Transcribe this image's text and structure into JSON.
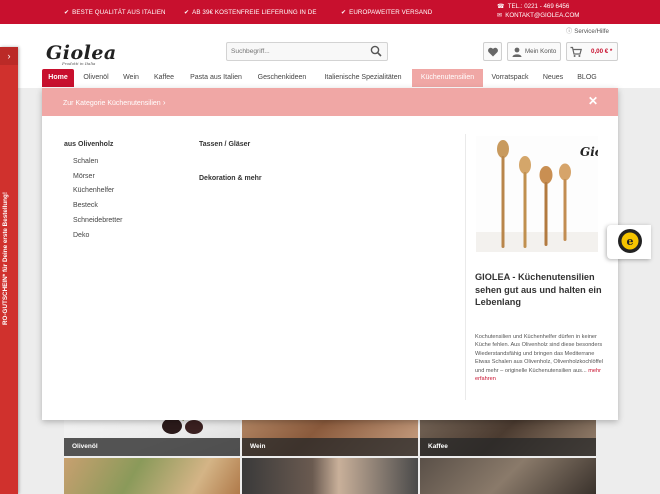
{
  "topbar": {
    "usps": [
      "BESTE QUALITÄT AUS ITALIEN",
      "AB 39€ KOSTENFREIE LIEFERUNG IN DE",
      "EUROPAWEITER VERSAND"
    ],
    "phone": "TEL.: 0221 - 469 6456",
    "email": "KONTAKT@GIOLEA.COM"
  },
  "header": {
    "logo": "Giolea",
    "tagline": "Prodotti in Italia",
    "service_label": "Service/Hilfe",
    "search_placeholder": "Suchbegriff...",
    "account_label": "Mein Konto",
    "cart_total": "0,00 € *"
  },
  "nav": {
    "items": [
      "Home",
      "Olivenöl",
      "Wein",
      "Kaffee",
      "Pasta aus Italien",
      "Geschenkideen",
      "Italienische Spezialitäten",
      "Küchenutensilien",
      "Vorratspack",
      "Neues",
      "BLOG"
    ]
  },
  "sidetab": {
    "text": "RO-GUTSCHEIN* für Deine erste Bestellung!"
  },
  "dropdown": {
    "category_link": "Zur Kategorie Küchenutensilien",
    "columns": [
      {
        "title": "aus Olivenholz",
        "items": [
          "Schalen",
          "Mörser",
          "Küchenhelfer",
          "Besteck",
          "Schneidebretter",
          "Deko"
        ]
      },
      {
        "title": "Tassen / Gläser",
        "items": []
      },
      {
        "title": "Dekoration & mehr",
        "items": []
      }
    ],
    "teaser": {
      "image_logo": "Giolea",
      "title": "GIOLEA - Küchenutensilien sehen gut aus und halten ein Lebenlang",
      "text": "Kochutensilien und Küchenhelfer dürfen in keiner Küche fehlen. Aus Olivenholz sind diese besonders Wiederstandsfähig und bringen das Mediterrane Etwas Schalen aus Olivenholz, Olivenholzkochlöffel und mehr – originelle Küchenutensilien aus...",
      "more": "mehr erfahren"
    }
  },
  "tiles": [
    "Olivenöl",
    "Wein",
    "Kaffee"
  ],
  "colors": {
    "brand_red": "#c8102e",
    "nav_active": "#f0a7a5",
    "price_red": "#c8102e"
  }
}
